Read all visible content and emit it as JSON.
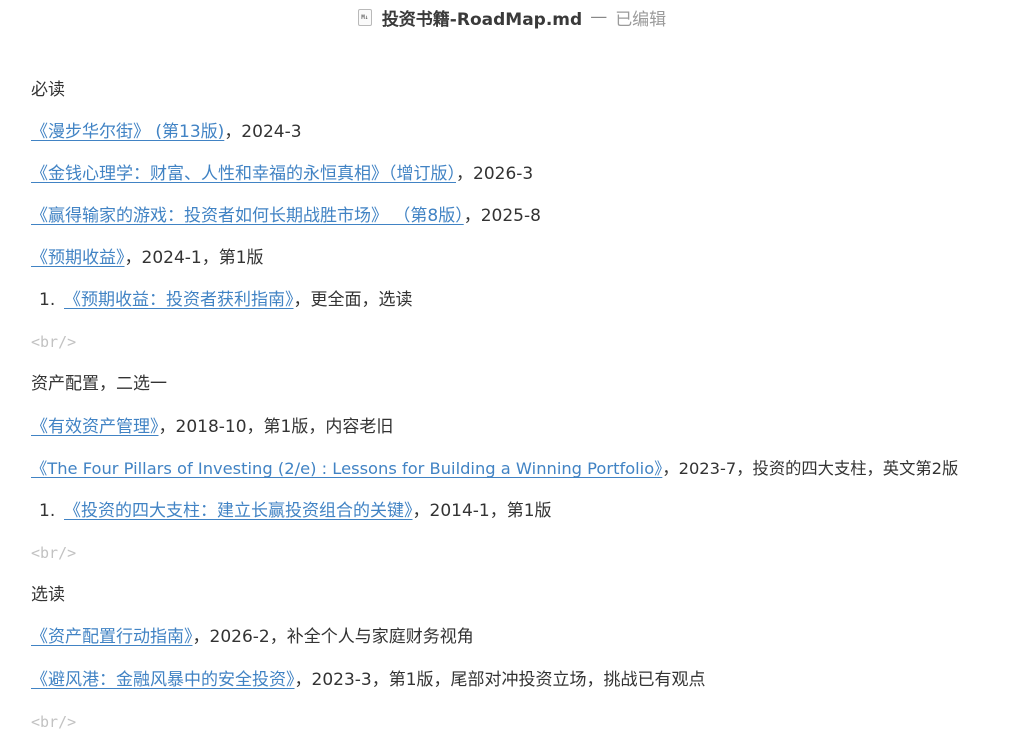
{
  "window": {
    "file_icon": "markdown-file-icon",
    "icon_glyph": "M↓",
    "title": "投资书籍-RoadMap.md",
    "separator": "—",
    "status": "已编辑"
  },
  "sections": {
    "must_read": {
      "heading": "必读",
      "items": [
        {
          "link": "《漫步华尔街》 (第13版)",
          "rest": "，2024-3"
        },
        {
          "link": "《金钱心理学：财富、人性和幸福的永恒真相》（增订版）",
          "rest": "，2026-3"
        },
        {
          "link": "《赢得输家的游戏：投资者如何长期战胜市场》 （第8版）",
          "rest": "，2025-8"
        },
        {
          "link": "《预期收益》",
          "rest": "，2024-1，第1版"
        }
      ],
      "sub_item": {
        "num": "1.",
        "link": "《预期收益：投资者获利指南》",
        "rest": "，更全面，选读"
      },
      "br": "<br/>"
    },
    "allocation": {
      "heading": "资产配置，二选一",
      "items": [
        {
          "link": "《有效资产管理》",
          "rest": "，2018-10，第1版，内容老旧"
        },
        {
          "link": "《The Four Pillars of Investing (2/e) : Lessons for Building a Winning Portfolio》",
          "rest": "，2023-7，投资的四大支柱，英文第2版"
        }
      ],
      "sub_item": {
        "num": "1.",
        "link": "《投资的四大支柱：建立长赢投资组合的关键》",
        "rest": "，2014-1，第1版"
      },
      "br": "<br/>"
    },
    "optional": {
      "heading": "选读",
      "items": [
        {
          "link": "《资产配置行动指南》",
          "rest": "，2026-2，补全个人与家庭财务视角"
        },
        {
          "link": "《避风港：金融风暴中的安全投资》",
          "rest": "，2023-3，第1版，尾部对冲投资立场，挑战已有观点"
        }
      ],
      "br": "<br/>"
    }
  }
}
